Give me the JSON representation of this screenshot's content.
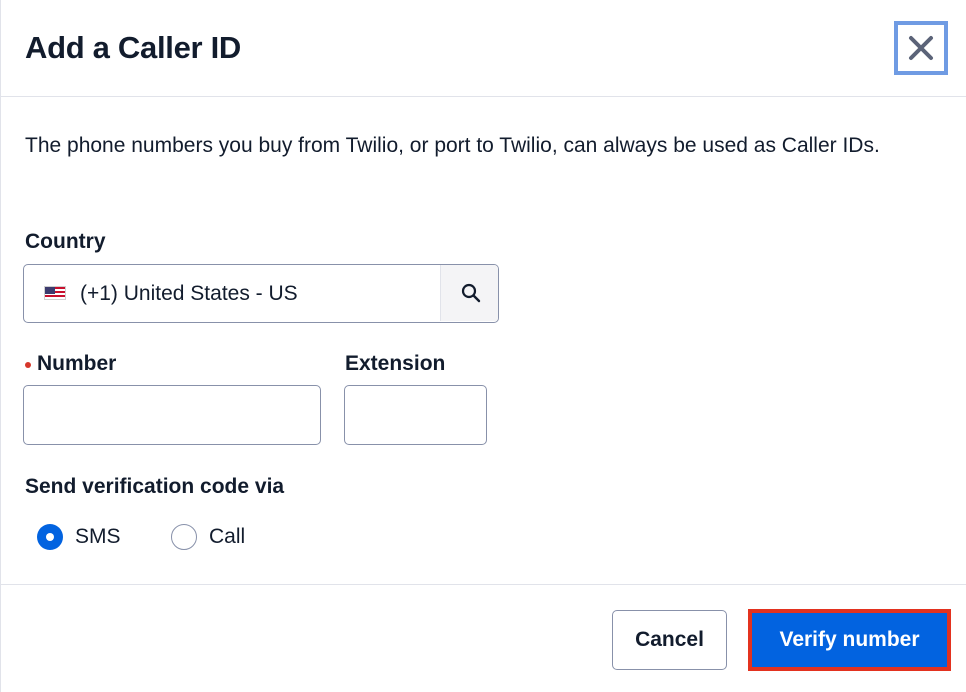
{
  "dialog": {
    "title": "Add a Caller ID",
    "close_label": "Close",
    "description": "The phone numbers you buy from Twilio, or port to Twilio, can always be used as Caller IDs."
  },
  "country": {
    "label": "Country",
    "selected_value": "(+1) United States - US",
    "flag_icon": "us-flag-icon",
    "search_icon": "search-icon"
  },
  "number": {
    "label": "Number",
    "required": true,
    "value": "",
    "placeholder": ""
  },
  "extension": {
    "label": "Extension",
    "value": "",
    "placeholder": ""
  },
  "verification": {
    "label": "Send verification code via",
    "options": [
      {
        "label": "SMS",
        "checked": true
      },
      {
        "label": "Call",
        "checked": false
      }
    ]
  },
  "footer": {
    "cancel_label": "Cancel",
    "verify_label": "Verify number"
  },
  "colors": {
    "primary": "#0263e0",
    "required": "#d6372b",
    "focus_outline": "#6f9be3",
    "highlight_outline": "#e3321f",
    "text": "#121c2d",
    "border": "#8891aa"
  }
}
